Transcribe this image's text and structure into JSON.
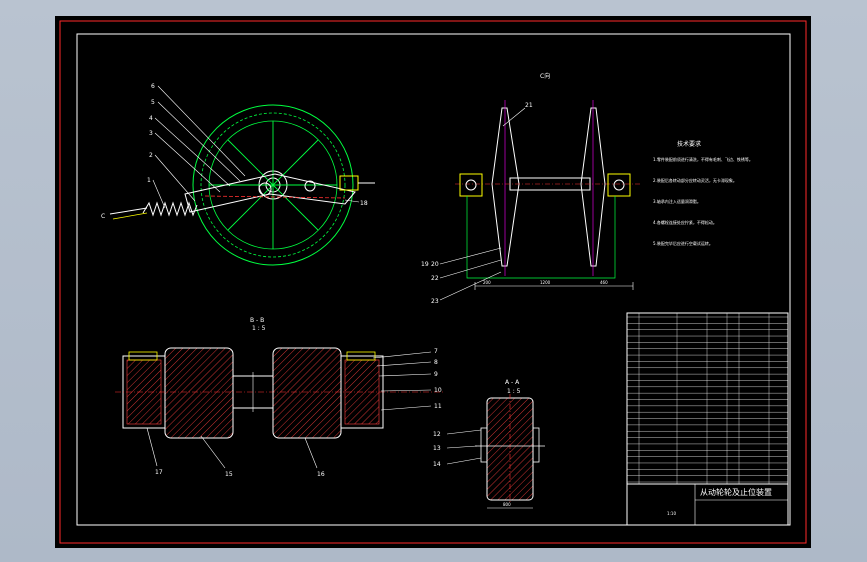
{
  "drawing": {
    "title_block_title": "从动轮轮及止位装置",
    "scale": "1:10",
    "tech_requirements_title": "技术要求",
    "tech_requirements": [
      "1.零件装配前须进行清洗，不得有毛刺、飞边、铁锈等。",
      "2.装配后各转动部分应转动灵活，无卡滞现象。",
      "3.轴承内注入适量润滑脂。",
      "4.各螺栓连接处应拧紧，不得松动。",
      "5.装配完毕后应进行空载试运转。"
    ],
    "views": {
      "top_view_label": "C向",
      "section_bb_label": "B - B",
      "section_bb_scale": "1 : 5",
      "section_aa_label": "A - A",
      "section_aa_scale": "1 : 5",
      "arrow_c": "C"
    },
    "balloons_left": [
      "6",
      "5",
      "4",
      "3",
      "2",
      "1"
    ],
    "balloon_wheel": "18",
    "balloons_top": [
      "21"
    ],
    "balloons_top_left": [
      "19",
      "20",
      "22",
      "23"
    ],
    "balloons_section_right": [
      "7",
      "8",
      "9",
      "10",
      "11"
    ],
    "balloons_section_bottom": [
      "17",
      "15",
      "16"
    ],
    "balloons_aa": [
      "12",
      "13",
      "14"
    ],
    "dimensions": {
      "top_overall": "1200",
      "top_left": "200",
      "top_right": "460",
      "aa_width": "800"
    }
  },
  "colors": {
    "frame": "#ff2a2a",
    "outline": "#ffffff",
    "green": "#00ff40",
    "yellow": "#ffff00",
    "red": "#ff3030",
    "magenta": "#ff00ff",
    "hatch": "#ff4040"
  }
}
